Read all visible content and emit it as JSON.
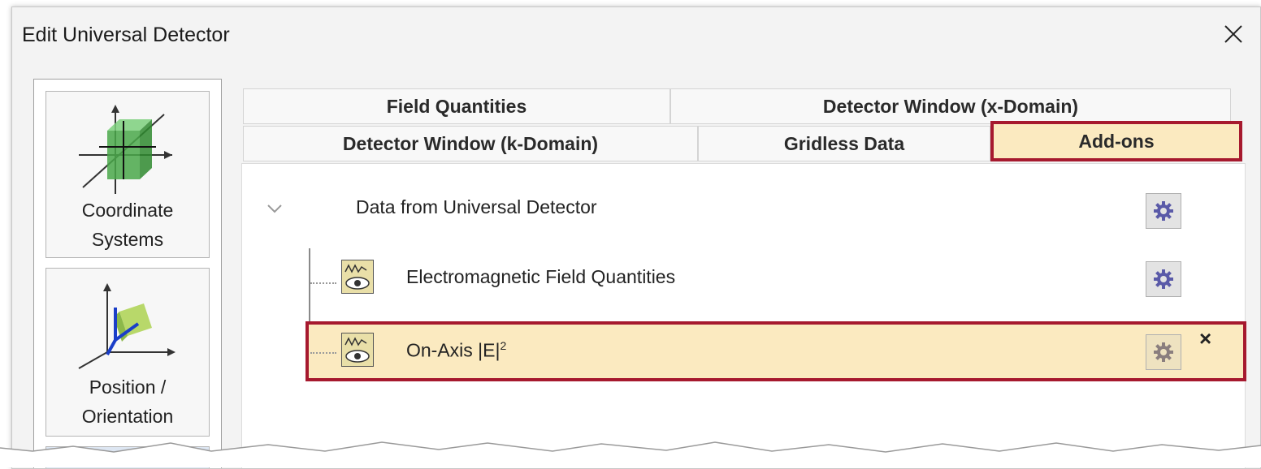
{
  "window": {
    "title": "Edit Universal Detector",
    "close_glyph": "✕"
  },
  "sidebar": {
    "items": [
      {
        "label_line1": "Coordinate",
        "label_line2": "Systems",
        "icon": "coordinate-systems-icon"
      },
      {
        "label_line1": "Position /",
        "label_line2": "Orientation",
        "icon": "position-orientation-icon"
      }
    ]
  },
  "tabs": {
    "row1": [
      "Field Quantities",
      "Detector Window (x-Domain)"
    ],
    "row2": [
      "Detector Window (k-Domain)",
      "Gridless Data",
      "Add-ons"
    ],
    "active": "Add-ons"
  },
  "addons": {
    "root": {
      "label": "Data from Universal Detector",
      "expanded": true
    },
    "children": [
      {
        "label": "Electromagnetic Field Quantities",
        "selected": false
      },
      {
        "label": "On-Axis |E|",
        "superscript": "2",
        "selected": true
      }
    ],
    "remove_glyph": "×"
  },
  "colors": {
    "highlight_bg": "#fbeac0",
    "highlight_border": "#a6192e",
    "gear": "#5a5aa8"
  }
}
